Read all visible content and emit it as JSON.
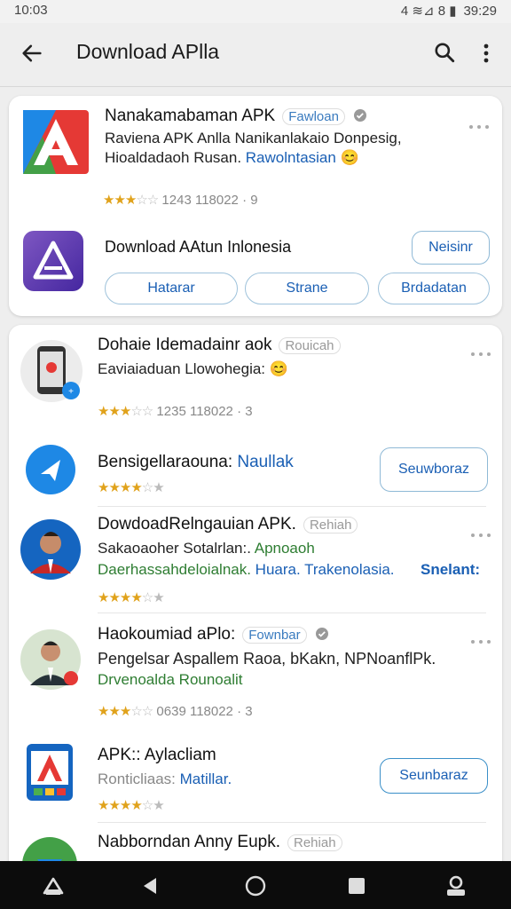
{
  "status": {
    "time": "10:03",
    "right": "4 ≋⊿ 8 ▮",
    "clock": "39:29"
  },
  "appbar": {
    "title": "Download APlla"
  },
  "card1": {
    "item1": {
      "title": "Nanakamabaman APK",
      "tag": "Fawloan",
      "line1": "Raviena APK Anlla Nanikanlakaio Donpesig,",
      "line2a": "Hioaldadaoh Rusan. ",
      "line2b": "Rawolntasian",
      "emoji": "😊",
      "rating": "1243 118022 · 9",
      "stars": "★★★",
      "stars_empty": "☆☆"
    },
    "item2": {
      "title": "Download AAtun Inlonesia",
      "button": "Neisinr",
      "pills": [
        "Hatarar",
        "Strane",
        "Brdadatan"
      ]
    }
  },
  "list": [
    {
      "title": "Dohaie Idemadainr aok",
      "tag": "Rouicah",
      "line1": "Eaviaiaduan Llowohegia:",
      "emoji": "😊",
      "rating": "1235 118022 · 3",
      "stars": "★★★",
      "stars_empty": "☆☆"
    },
    {
      "title_a": "Bensigellaraouna: ",
      "title_b": "Naullak",
      "stars": "★★★★",
      "stars_empty": "☆★",
      "button": "Seuwboraz"
    },
    {
      "title": "DowdoadRelngauian APK.",
      "tag": "Rehiah",
      "line1": "Sakaoaoher Sotalrlan:. ",
      "line1b": "Apnoaoh",
      "line2a": "Daerhassahdeloialnak. ",
      "line2b": "Huara. Trakenolasia.",
      "line2c": "Snelant:",
      "stars": "★★★★",
      "stars_empty": "☆★"
    },
    {
      "title": "Haokoumiad aPlo:",
      "tag": "Fownbar",
      "line1": "Pengelsar Aspallem Raoa, bKakn, NPNoanflPk.",
      "line2": "Drvenoalda Rounoalit",
      "rating": "0639 118022 · 3",
      "stars": "★★★",
      "stars_empty": "☆☆"
    },
    {
      "title": "APK:: Aylacliam",
      "line1a": "Ronticliaas: ",
      "line1b": "Matillar.",
      "stars": "★★★★",
      "stars_empty": "☆★",
      "button": "Seunbaraz"
    },
    {
      "title": "Nabborndan Anny Eupk.",
      "tag": "Rehiah"
    }
  ],
  "colors": {
    "accent": "#1a5fb4",
    "star": "#e0a21b",
    "green": "#2e7d32"
  }
}
